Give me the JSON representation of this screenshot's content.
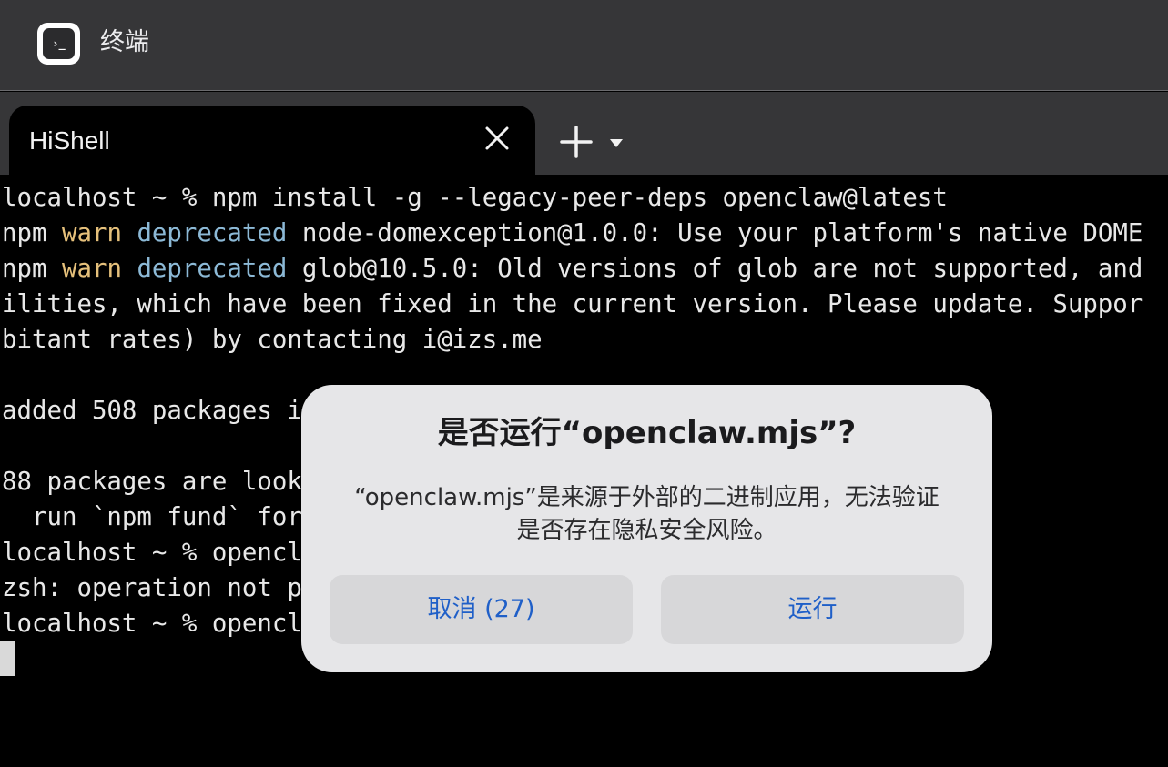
{
  "app": {
    "title": "终端",
    "icon_glyph": "›_",
    "icon": "terminal-icon"
  },
  "tabs": [
    {
      "label": "HiShell",
      "active": true
    }
  ],
  "tab_controls": {
    "close_icon": "close-icon",
    "new_tab_icon": "plus-icon",
    "menu_icon": "chevron-down-icon"
  },
  "terminal": {
    "lines": [
      {
        "segments": [
          {
            "text": "localhost ~ % npm install -g --legacy-peer-deps openclaw@latest"
          }
        ]
      },
      {
        "segments": [
          {
            "text": "npm "
          },
          {
            "text": "warn",
            "style": "warn"
          },
          {
            "text": " "
          },
          {
            "text": "deprecated",
            "style": "dep"
          },
          {
            "text": " node-domexception@1.0.0: Use your platform's native DOME"
          }
        ]
      },
      {
        "segments": [
          {
            "text": "npm "
          },
          {
            "text": "warn",
            "style": "warn"
          },
          {
            "text": " "
          },
          {
            "text": "deprecated",
            "style": "dep"
          },
          {
            "text": " glob@10.5.0: Old versions of glob are not supported, and"
          }
        ]
      },
      {
        "segments": [
          {
            "text": "ilities, which have been fixed in the current version. Please update. Suppor"
          }
        ]
      },
      {
        "segments": [
          {
            "text": "bitant rates) by contacting i@izs.me"
          }
        ]
      },
      {
        "segments": [
          {
            "text": ""
          }
        ]
      },
      {
        "segments": [
          {
            "text": "added 508 packages i"
          }
        ]
      },
      {
        "segments": [
          {
            "text": ""
          }
        ]
      },
      {
        "segments": [
          {
            "text": "88 packages are look"
          }
        ]
      },
      {
        "segments": [
          {
            "text": "  run `npm fund` for"
          }
        ]
      },
      {
        "segments": [
          {
            "text": "localhost ~ % opencl"
          }
        ]
      },
      {
        "segments": [
          {
            "text": "zsh: operation not p"
          }
        ]
      },
      {
        "segments": [
          {
            "text": "localhost ~ % opencl"
          }
        ]
      }
    ],
    "colors": {
      "text": "#e8e8e8",
      "warn": "#e5c07b",
      "deprecated": "#8cb9d6",
      "background": "#000000"
    }
  },
  "dialog": {
    "title": "是否运行“openclaw.mjs”?",
    "message": "“openclaw.mjs”是来源于外部的二进制应用，无法验证是否存在隐私安全风险。",
    "cancel_label": "取消 (27)",
    "run_label": "运行",
    "button_text_color": "#1f5fc8"
  }
}
